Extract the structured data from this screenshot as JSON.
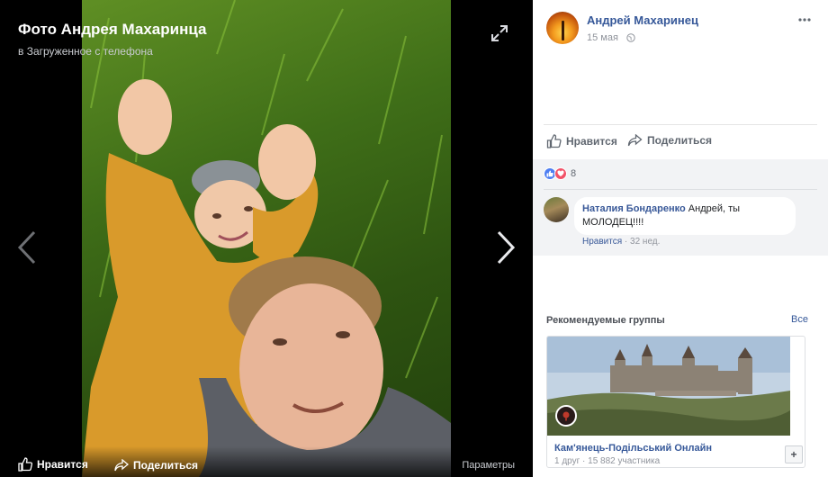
{
  "viewer": {
    "title": "Фото Андрея Махаринца",
    "subtitle": "в Загруженное с телефона",
    "like_label": "Нравится",
    "share_label": "Поделиться",
    "params_label": "Параметры"
  },
  "post": {
    "author": "Андрей Махаринец",
    "date": "15 мая",
    "like_label": "Нравится",
    "share_label": "Поделиться",
    "reaction_count": "8"
  },
  "comment": {
    "author": "Наталия Бондаренко",
    "text": "Андрей, ты МОЛОДЕЦ!!!!",
    "like_label": "Нравится",
    "separator": " · ",
    "age": "32 нед."
  },
  "groups": {
    "title": "Рекомендуемые группы",
    "all_label": "Все",
    "card": {
      "name": "Кам'янець-Подільський Онлайн",
      "stats": "1 друг · 15 882 участника",
      "join_label": "+"
    }
  },
  "colors": {
    "link": "#365899",
    "panel_bg": "#f2f3f5",
    "viewer_bg": "#000000"
  },
  "icons": [
    "expand-icon",
    "chevron-left-icon",
    "chevron-right-icon",
    "thumbs-up-icon",
    "share-arrow-icon",
    "globe-icon",
    "more-icon",
    "heart-icon"
  ]
}
